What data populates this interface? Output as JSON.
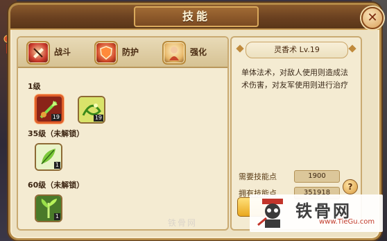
{
  "window": {
    "title": "技能",
    "close_glyph": "✕"
  },
  "tabs": [
    {
      "label": "战斗",
      "icon": "battle-icon"
    },
    {
      "label": "防护",
      "icon": "shield-icon"
    },
    {
      "label": "强化",
      "icon": "enhance-icon"
    }
  ],
  "sections": [
    {
      "label": "1级",
      "skills": [
        {
          "level": "19",
          "icon": "leaf-dart-icon",
          "selected": true
        },
        {
          "level": "19",
          "icon": "vine-swirl-icon",
          "selected": false
        }
      ]
    },
    {
      "label": "35级（未解锁）",
      "skills": [
        {
          "level": "1",
          "icon": "leaf-heal-icon",
          "selected": false
        }
      ]
    },
    {
      "label": "60级（未解锁）",
      "skills": [
        {
          "level": "1",
          "icon": "plant-burst-icon",
          "selected": false
        }
      ]
    }
  ],
  "detail": {
    "skill_name": "灵香术 Lv.19",
    "description": "单体法术，对敌人使用则造成法术伤害，对友军使用则进行治疗",
    "required_points_label": "需要技能点",
    "required_points_value": "1900",
    "owned_points_label": "拥有技能点",
    "owned_points_value": "351918",
    "help_glyph": "?"
  },
  "watermarks": {
    "left": "铁骨网",
    "right_title": "铁骨网",
    "right_url": "www.TieGu.com"
  },
  "colors": {
    "panel_bg": "#ede2c4",
    "title_bar": "#6a4020",
    "selected_border": "#e0602a"
  }
}
